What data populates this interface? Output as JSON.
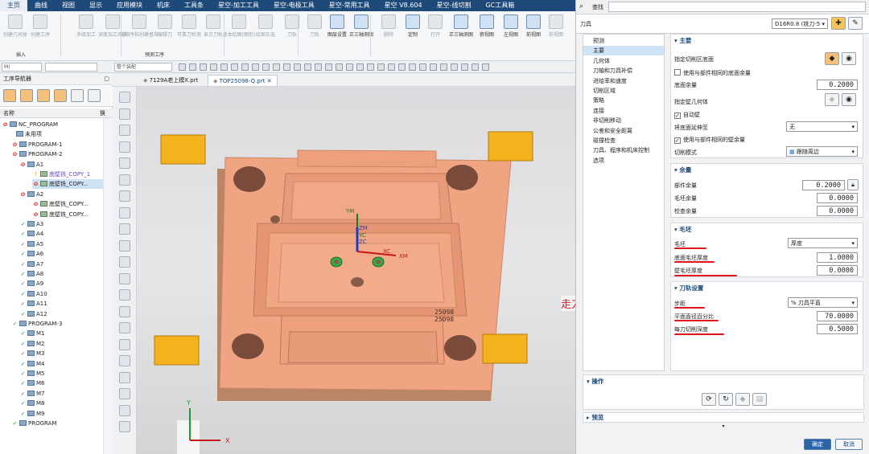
{
  "menubar": {
    "items": [
      "主页",
      "曲线",
      "视图",
      "显示",
      "应用模块",
      "机床",
      "工具条",
      "星空-加工工具",
      "星空-电极工具",
      "星空-常用工具",
      "星空 V8.604",
      "星空-线切割",
      "GC工具箱"
    ]
  },
  "ribbon": {
    "buttons": [
      "创建几何体",
      "创建工序",
      "多级加工",
      "深度加工阅读",
      "按顺序和创建基准",
      "编辑刀",
      "可靠刀检测",
      "显示刀轨",
      "基本绘图(图形)",
      "绘图灰选",
      "刀轨",
      "刀轨",
      "图层设置",
      "正三轴测图",
      "删除",
      "定制",
      "打开",
      "正三轴测图",
      "俯视图",
      "左视图",
      "前视图",
      "前视图"
    ],
    "groups": {
      "insert": "插入",
      "forecast": "预测工序"
    }
  },
  "toolbar2": {
    "combo1": "M)",
    "combo2": "整个装配"
  },
  "navigator": {
    "title": "工序导航器",
    "col_name": "名称",
    "col_tool": "换",
    "rows": [
      {
        "text": "NC_PROGRAM",
        "status": "no"
      },
      {
        "text": "未用项",
        "status": ""
      },
      {
        "text": "PROGRAM-1",
        "status": "no"
      },
      {
        "text": "PROGRAM-2",
        "status": "no"
      },
      {
        "text": "A1",
        "status": "no"
      },
      {
        "text": "底壁铣_COPY_1",
        "status": "warn"
      },
      {
        "text": "底壁铣_COPY...",
        "status": "no"
      },
      {
        "text": "A2",
        "status": "no"
      },
      {
        "text": "底壁铣_COPY...",
        "status": "no"
      },
      {
        "text": "底壁铣_COPY...",
        "status": "no"
      },
      {
        "text": "A3",
        "status": "ok"
      },
      {
        "text": "A4",
        "status": "ok"
      },
      {
        "text": "A5",
        "status": "ok"
      },
      {
        "text": "A6",
        "status": "ok"
      },
      {
        "text": "A7",
        "status": "ok"
      },
      {
        "text": "A8",
        "status": "ok"
      },
      {
        "text": "A9",
        "status": "ok"
      },
      {
        "text": "A10",
        "status": "ok"
      },
      {
        "text": "A11",
        "status": "ok"
      },
      {
        "text": "A12",
        "status": "ok"
      },
      {
        "text": "PROGRAM-3",
        "status": "ok"
      },
      {
        "text": "M1",
        "status": "ok"
      },
      {
        "text": "M2",
        "status": "ok"
      },
      {
        "text": "M3",
        "status": "ok"
      },
      {
        "text": "M4",
        "status": "ok"
      },
      {
        "text": "M5",
        "status": "ok"
      },
      {
        "text": "M6",
        "status": "ok"
      },
      {
        "text": "M7",
        "status": "ok"
      },
      {
        "text": "M8",
        "status": "ok"
      },
      {
        "text": "M9",
        "status": "ok"
      },
      {
        "text": "PROGRAM",
        "status": "ok"
      }
    ]
  },
  "tabs": [
    "7129A老上模X.prt",
    "TOP25098-Q.prt"
  ],
  "viewport": {
    "axis_ym": "YM",
    "axis_zm": "ZM",
    "axis_xm": "XM",
    "axis_yc": "YC",
    "axis_zc": "ZC",
    "axis_xc": "XC",
    "triad_y": "Y",
    "triad_x": "X",
    "engrave1": "25098",
    "engrave2": "25098",
    "annotation": "走刀间距设置"
  },
  "dialog": {
    "search_label": "查找",
    "tool_label": "刀具",
    "tool_value": "D16R0.8 (铣刀-5",
    "nav_items": [
      "预测",
      "主要",
      "几何体",
      "刀轴和刀具补偿",
      "进给率和速度",
      "切削区域",
      "策略",
      "连接",
      "非切削移动",
      "公差和安全距离",
      "碰撞检查",
      "刀具、程序和机床控制",
      "选项"
    ],
    "main": {
      "title": "主要",
      "floor_label": "指定切削区底面",
      "cb_use_floor": "使用与部件相同的底面余量",
      "floor_stock_label": "底面余量",
      "floor_stock": "0.2000",
      "wall_label": "指定壁几何体",
      "cb_auto_wall": "自动壁",
      "extend_label": "将底面延伸至",
      "extend_value": "无",
      "cb_use_wall": "使用与部件相同的壁余量",
      "cut_mode_label": "切削模式",
      "cut_mode_value": "跟随周边"
    },
    "stock": {
      "title": "余量",
      "part_label": "部件余量",
      "part_value": "0.2000",
      "blank_label": "毛坯余量",
      "blank_value": "0.0000",
      "check_label": "检查余量",
      "check_value": "0.0000"
    },
    "blank": {
      "title": "毛坯",
      "blank_label": "毛坯",
      "blank_value": "厚度",
      "floor_thk_label": "底面毛坯厚度",
      "floor_thk": "1.0000",
      "wall_thk_label": "壁毛坯厚度",
      "wall_thk": "0.0000"
    },
    "path": {
      "title": "刀轨设置",
      "step_label": "步距",
      "step_value": "% 刀具平直",
      "pct_label": "平面直径百分比",
      "pct_value": "70.0000",
      "depth_label": "每刀切削深度",
      "depth_value": "0.5000"
    },
    "ops_title": "操作",
    "preview_title": "预览",
    "ok": "确定",
    "cancel": "取消"
  },
  "colors": {
    "accent": "#1e4a7a",
    "part": "#f0a482",
    "clamp": "#f5b21c",
    "annotation": "#e2141c"
  }
}
